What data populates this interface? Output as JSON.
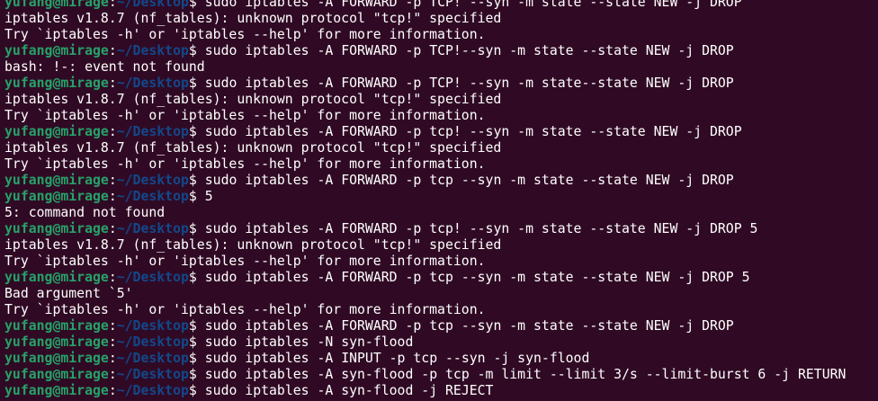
{
  "terminal": {
    "lines": [
      {
        "kind": "prompt",
        "user": "yufang@mirage",
        "sep": ":",
        "path": "~/Desktop",
        "sym": "$",
        "cmd": " sudo iptables -A FORWARD -p TCP! --syn -m state --state NEW -j DROP"
      },
      {
        "kind": "output",
        "text": "iptables v1.8.7 (nf_tables): unknown protocol \"tcp!\" specified"
      },
      {
        "kind": "output",
        "text": "Try `iptables -h' or 'iptables --help' for more information."
      },
      {
        "kind": "prompt",
        "user": "yufang@mirage",
        "sep": ":",
        "path": "~/Desktop",
        "sym": "$",
        "cmd": " sudo iptables -A FORWARD -p TCP!--syn -m state --state NEW -j DROP"
      },
      {
        "kind": "output",
        "text": "bash: !-: event not found"
      },
      {
        "kind": "prompt",
        "user": "yufang@mirage",
        "sep": ":",
        "path": "~/Desktop",
        "sym": "$",
        "cmd": " sudo iptables -A FORWARD -p TCP! --syn -m state--state NEW -j DROP"
      },
      {
        "kind": "output",
        "text": "iptables v1.8.7 (nf_tables): unknown protocol \"tcp!\" specified"
      },
      {
        "kind": "output",
        "text": "Try `iptables -h' or 'iptables --help' for more information."
      },
      {
        "kind": "prompt",
        "user": "yufang@mirage",
        "sep": ":",
        "path": "~/Desktop",
        "sym": "$",
        "cmd": " sudo iptables -A FORWARD -p tcp! --syn -m state --state NEW -j DROP"
      },
      {
        "kind": "output",
        "text": "iptables v1.8.7 (nf_tables): unknown protocol \"tcp!\" specified"
      },
      {
        "kind": "output",
        "text": "Try `iptables -h' or 'iptables --help' for more information."
      },
      {
        "kind": "prompt",
        "user": "yufang@mirage",
        "sep": ":",
        "path": "~/Desktop",
        "sym": "$",
        "cmd": " sudo iptables -A FORWARD -p tcp --syn -m state --state NEW -j DROP"
      },
      {
        "kind": "prompt",
        "user": "yufang@mirage",
        "sep": ":",
        "path": "~/Desktop",
        "sym": "$",
        "cmd": " 5"
      },
      {
        "kind": "output",
        "text": "5: command not found"
      },
      {
        "kind": "prompt",
        "user": "yufang@mirage",
        "sep": ":",
        "path": "~/Desktop",
        "sym": "$",
        "cmd": " sudo iptables -A FORWARD -p tcp! --syn -m state --state NEW -j DROP 5"
      },
      {
        "kind": "output",
        "text": "iptables v1.8.7 (nf_tables): unknown protocol \"tcp!\" specified"
      },
      {
        "kind": "output",
        "text": "Try `iptables -h' or 'iptables --help' for more information."
      },
      {
        "kind": "prompt",
        "user": "yufang@mirage",
        "sep": ":",
        "path": "~/Desktop",
        "sym": "$",
        "cmd": " sudo iptables -A FORWARD -p tcp --syn -m state --state NEW -j DROP 5"
      },
      {
        "kind": "output",
        "text": "Bad argument `5'"
      },
      {
        "kind": "output",
        "text": "Try `iptables -h' or 'iptables --help' for more information."
      },
      {
        "kind": "prompt",
        "user": "yufang@mirage",
        "sep": ":",
        "path": "~/Desktop",
        "sym": "$",
        "cmd": " sudo iptables -A FORWARD -p tcp --syn -m state --state NEW -j DROP"
      },
      {
        "kind": "prompt",
        "user": "yufang@mirage",
        "sep": ":",
        "path": "~/Desktop",
        "sym": "$",
        "cmd": " sudo iptables -N syn-flood"
      },
      {
        "kind": "prompt",
        "user": "yufang@mirage",
        "sep": ":",
        "path": "~/Desktop",
        "sym": "$",
        "cmd": " sudo iptables -A INPUT -p tcp --syn -j syn-flood"
      },
      {
        "kind": "prompt",
        "user": "yufang@mirage",
        "sep": ":",
        "path": "~/Desktop",
        "sym": "$",
        "cmd": " sudo iptables -A syn-flood -p tcp -m limit --limit 3/s --limit-burst 6 -j RETURN"
      },
      {
        "kind": "prompt",
        "user": "yufang@mirage",
        "sep": ":",
        "path": "~/Desktop",
        "sym": "$",
        "cmd": " sudo iptables -A syn-flood -j REJECT"
      }
    ]
  },
  "colors": {
    "background": "#300a24",
    "user": "#26a269",
    "path": "#12488b",
    "text": "#ffffff"
  }
}
